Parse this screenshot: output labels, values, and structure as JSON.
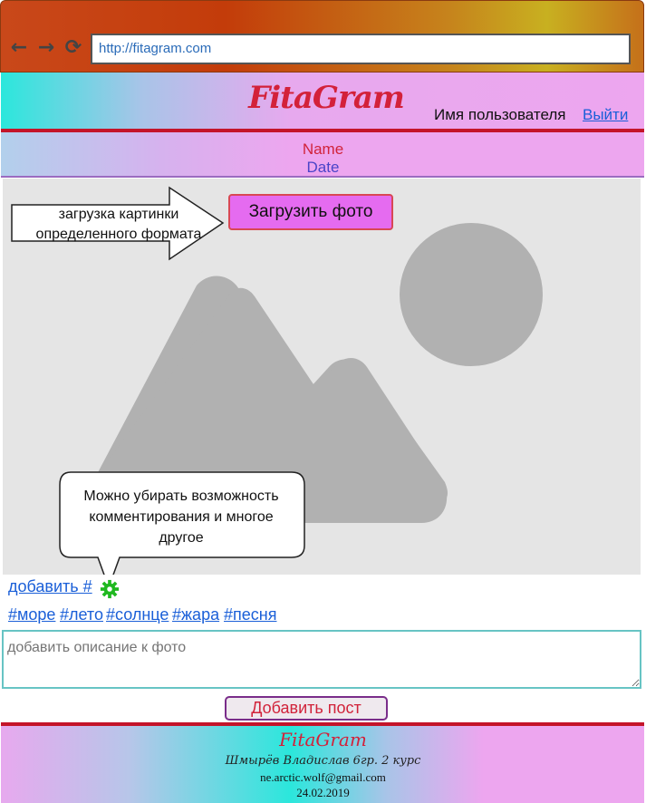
{
  "browser": {
    "url": "http://fitagram.com",
    "nav_icons": [
      "back-arrow-icon",
      "forward-arrow-icon",
      "reload-icon"
    ]
  },
  "header": {
    "logo": "FitaGram",
    "username": "Имя пользователя",
    "logout": "Выйти"
  },
  "post_info": {
    "name": "Name",
    "date": "Date"
  },
  "upload": {
    "button_label": "Загрузить фото",
    "annotation": "загрузка картинки определенного формата"
  },
  "photo": {
    "placeholder_icon": "image-placeholder-icon"
  },
  "comment_note": "Можно убирать возможность комментирования и многое другое",
  "tags": {
    "add_label": "добавить #",
    "settings_icon": "gear-icon",
    "items": [
      "#море",
      "#лето",
      "#солнце",
      "#жара",
      "#песня"
    ]
  },
  "description": {
    "placeholder": "добавить описание к фото"
  },
  "post_button": "Добавить пост",
  "footer": {
    "logo": "FitaGram",
    "author": "Шмырёв Владислав 6гр. 2 курс",
    "email": "ne.arctic.wolf@gmail.com",
    "date": "24.02.2019"
  },
  "colors": {
    "accent_red": "#d3213a",
    "link_blue": "#1a5fd8",
    "upload_button": "#e56bf0",
    "gear_green": "#1fb81f"
  }
}
